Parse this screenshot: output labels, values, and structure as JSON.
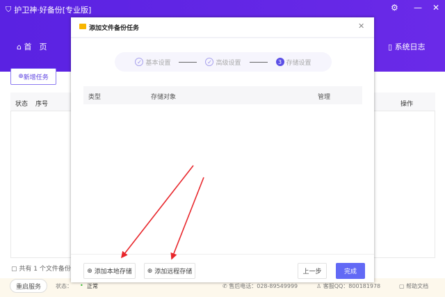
{
  "app": {
    "title": "护卫神·好备份[专业版]",
    "nav_home": "首　页",
    "nav_log": "系统日志"
  },
  "main": {
    "new_task": "新增任务",
    "columns": [
      "状态",
      "序号",
      "操作"
    ],
    "summary": "共有 1 个文件备份任"
  },
  "footer": {
    "restart": "重启服务",
    "status_label": "状态：",
    "status_value": "正常",
    "phone": "售后电话：028-89549999",
    "qq": "客服QQ：800181978",
    "help": "帮助文档"
  },
  "dialog": {
    "title": "添加文件备份任务",
    "steps": [
      {
        "label": "基本设置",
        "state": "done"
      },
      {
        "label": "高级设置",
        "state": "done"
      },
      {
        "label": "存储设置",
        "num": "3",
        "state": "active"
      }
    ],
    "columns": [
      "类型",
      "存储对象",
      "管理"
    ],
    "add_local": "添加本地存储",
    "add_remote": "添加远程存储",
    "prev": "上一步",
    "finish": "完成"
  },
  "colors": {
    "purple": "#5a22e2",
    "accent": "#6269f5",
    "arrow": "#e8262b"
  }
}
